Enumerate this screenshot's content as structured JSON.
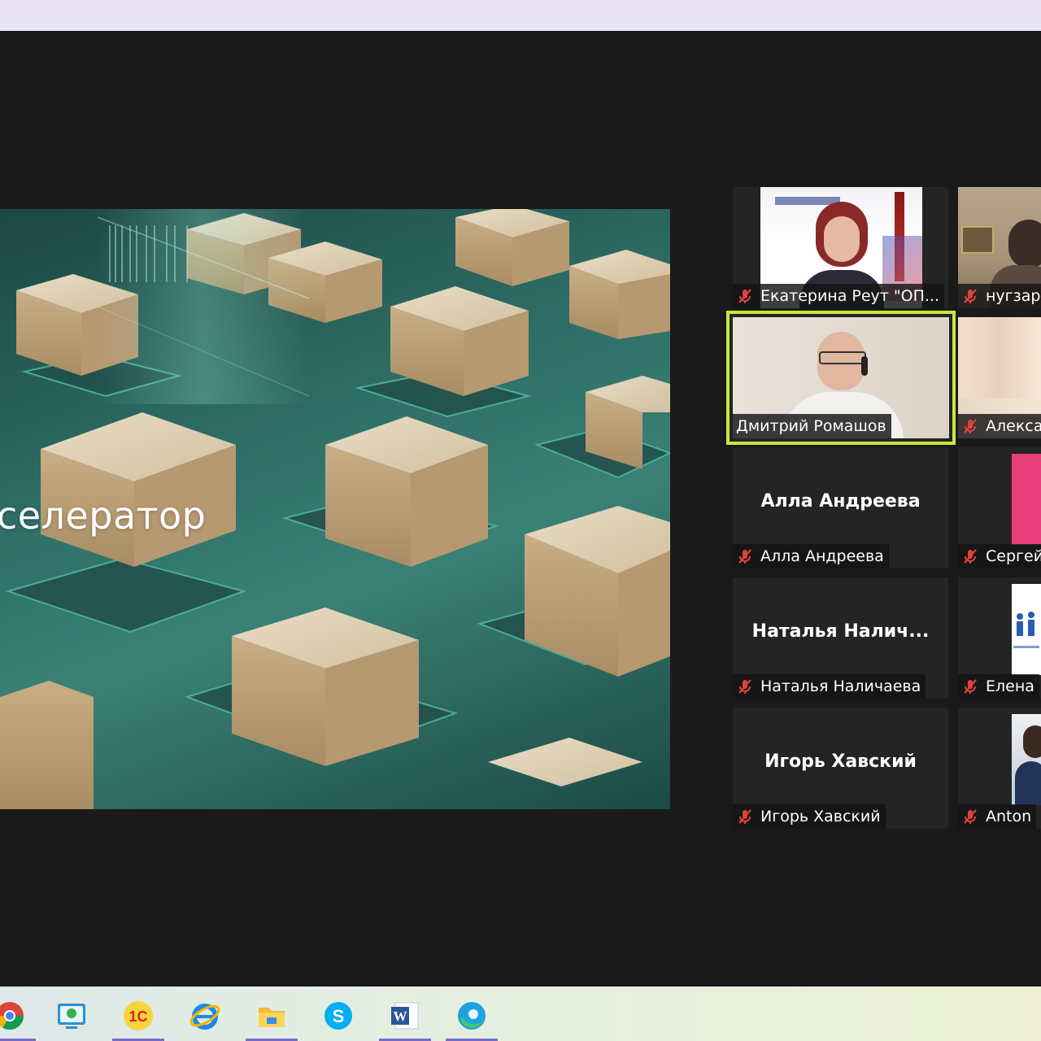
{
  "slide": {
    "title": "селератор"
  },
  "participants": [
    {
      "id": "ekaterina",
      "label": "Екатерина Реут \"ОП...",
      "big_name": "",
      "muted": true
    },
    {
      "id": "nugzar",
      "label": "нугзар",
      "big_name": "",
      "muted": true
    },
    {
      "id": "dmitry",
      "label": "Дмитрий Ромашов",
      "big_name": "",
      "muted": false,
      "speaking": true
    },
    {
      "id": "aleksa",
      "label": "Алекса",
      "big_name": "",
      "muted": true
    },
    {
      "id": "alla",
      "label": "Алла Андреева",
      "big_name": "Алла Андреева",
      "muted": true
    },
    {
      "id": "sergei",
      "label": "Сергей",
      "big_name": "",
      "muted": true
    },
    {
      "id": "natalya",
      "label": "Наталья Наличаева",
      "big_name": "Наталья  Налич...",
      "muted": true
    },
    {
      "id": "elena",
      "label": "Елена",
      "big_name": "",
      "muted": true
    },
    {
      "id": "igor",
      "label": "Игорь Хавский",
      "big_name": "Игорь Хавский",
      "muted": true
    },
    {
      "id": "anton",
      "label": "Anton",
      "big_name": "",
      "muted": true
    }
  ],
  "colors": {
    "speaking_border": "#c8e83a",
    "muted_mic": "#e0433c",
    "taskbar_active": "#7a6cc8"
  },
  "taskbar": [
    {
      "name": "chrome-icon"
    },
    {
      "name": "remote-support-icon"
    },
    {
      "name": "1c-icon",
      "text": "1С"
    },
    {
      "name": "internet-explorer-icon"
    },
    {
      "name": "file-explorer-icon"
    },
    {
      "name": "skype-icon",
      "text": "S"
    },
    {
      "name": "word-icon",
      "text": "W"
    },
    {
      "name": "edge-icon"
    }
  ]
}
